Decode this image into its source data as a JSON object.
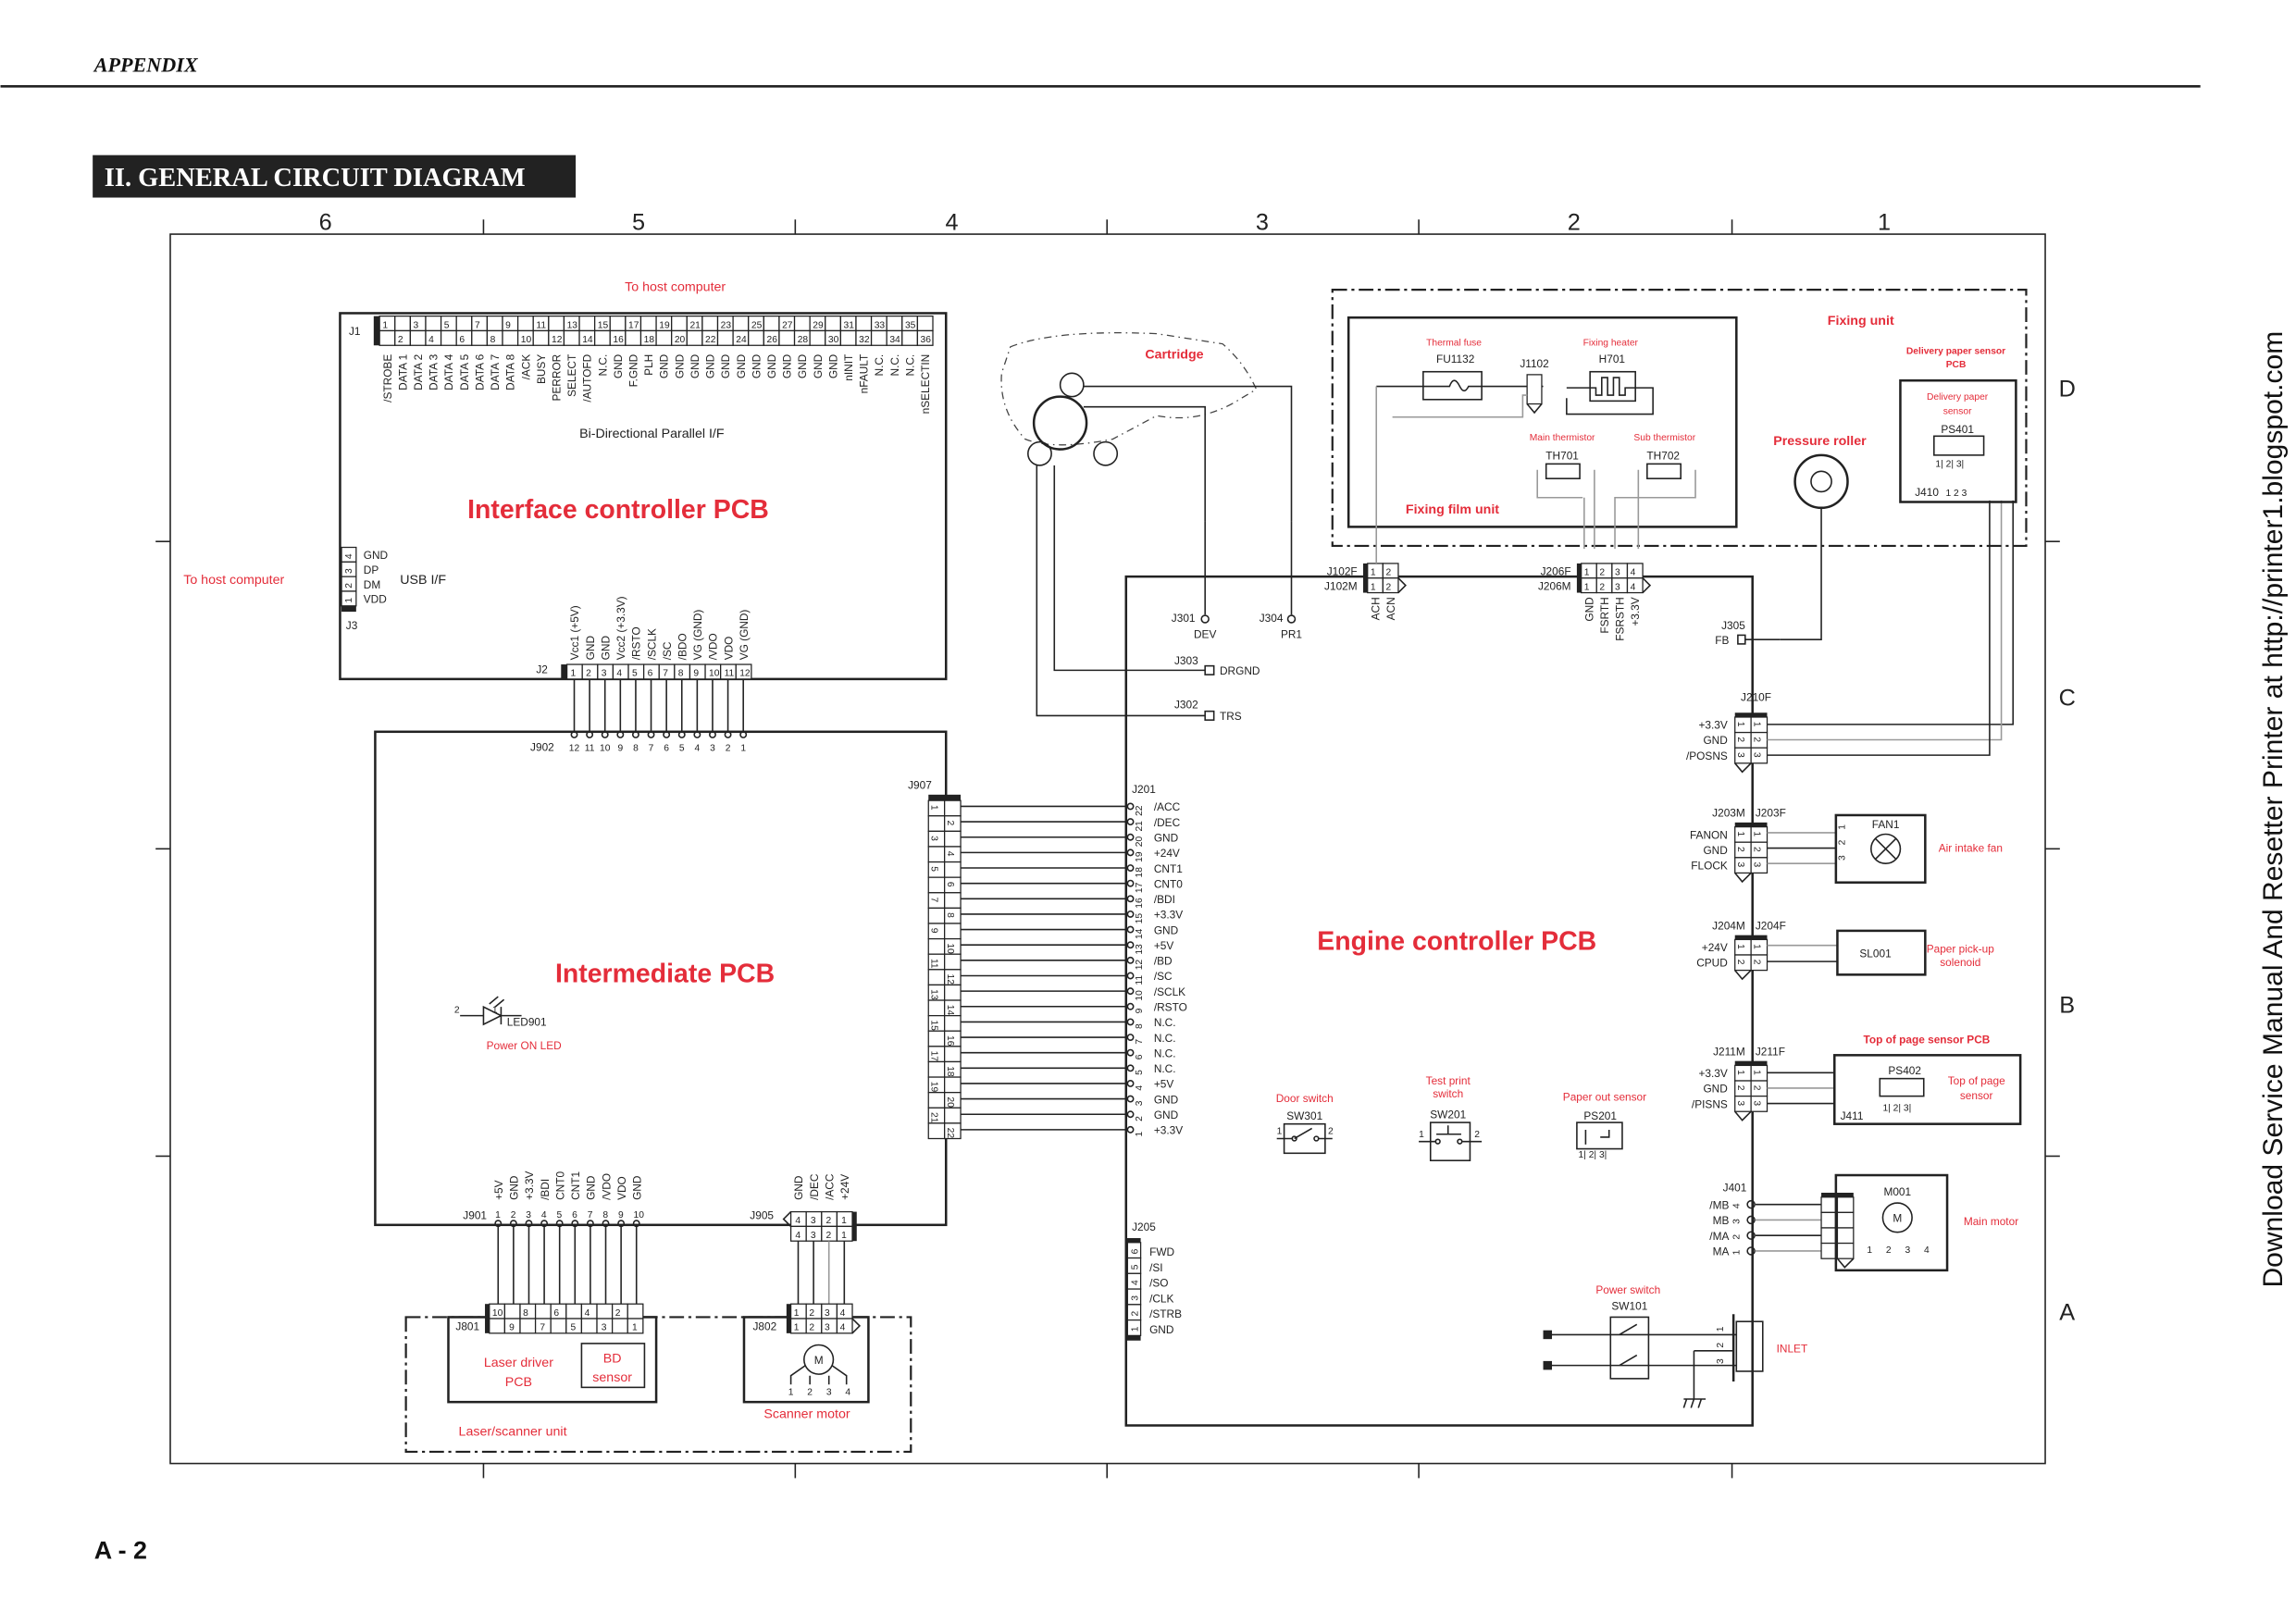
{
  "header": {
    "section": "APPENDIX",
    "title": "II. GENERAL CIRCUIT DIAGRAM",
    "page": "A - 2",
    "side_note": "Download Service Manual And Resetter Printer at http://printer1.blogspot.com"
  },
  "grid": {
    "columns": [
      "6",
      "5",
      "4",
      "3",
      "2",
      "1"
    ],
    "rows": [
      "D",
      "C",
      "B",
      "A"
    ]
  },
  "colors": {
    "label_red": "#e42d3a",
    "line": "#222222",
    "title_bg": "#222222"
  },
  "interface": {
    "title": "Interface controller PCB",
    "to_host_top": "To host computer",
    "to_host_left": "To host computer",
    "j1": {
      "name": "J1",
      "caption": "Bi-Directional Parallel I/F",
      "signals": [
        "/STROBE",
        "DATA 1",
        "DATA 2",
        "DATA 3",
        "DATA 4",
        "DATA 5",
        "DATA 6",
        "DATA 7",
        "DATA 8",
        "/ACK",
        "BUSY",
        "PERROR",
        "SELECT",
        "/AUTOFD",
        "N.C.",
        "GND",
        "F.GND",
        "PLH",
        "GND",
        "GND",
        "GND",
        "GND",
        "GND",
        "GND",
        "GND",
        "GND",
        "GND",
        "GND",
        "GND",
        "GND",
        "nINIT",
        "nFAULT",
        "N.C.",
        "N.C.",
        "N.C.",
        "nSELECTIN"
      ]
    },
    "j3": {
      "name": "J3",
      "caption": "USB I/F",
      "signals": [
        "GND",
        "DP",
        "DM",
        "VDD"
      ],
      "pins": [
        "4",
        "3",
        "2",
        "1"
      ]
    },
    "j2": {
      "name": "J2",
      "signals": [
        "Vcc1 (+5V)",
        "GND",
        "GND",
        "Vcc2 (+3.3V)",
        "/RSTO",
        "/SCLK",
        "/SC",
        "/BDO",
        "VG (GND)",
        "/VDO",
        "VDO",
        "VG (GND)"
      ]
    }
  },
  "intermediate": {
    "title": "Intermediate PCB",
    "j902": {
      "name": "J902",
      "pins": [
        "12",
        "11",
        "10",
        "9",
        "8",
        "7",
        "6",
        "5",
        "4",
        "3",
        "2",
        "1"
      ]
    },
    "j907": {
      "name": "J907"
    },
    "led": {
      "name": "LED901",
      "caption": "Power ON LED",
      "pin_a": "2",
      "pin_b": "1"
    },
    "j901": {
      "name": "J901",
      "signals": [
        "+5V",
        "GND",
        "+3.3V",
        "/BDI",
        "CNT0",
        "CNT1",
        "GND",
        "/VDO",
        "VDO",
        "GND"
      ]
    },
    "j905": {
      "name": "J905",
      "signals": [
        "GND",
        "/DEC",
        "/ACC",
        "+24V"
      ],
      "pins": [
        "4",
        "3",
        "2",
        "1"
      ]
    }
  },
  "laser_unit": {
    "title": "Laser/scanner unit",
    "driver": "Laser driver PCB",
    "driver_l1": "Laser driver",
    "driver_l2": "PCB",
    "bd_l1": "BD",
    "bd_l2": "sensor",
    "j801": {
      "name": "J801",
      "top": [
        "10",
        "",
        "8",
        "",
        "6",
        "",
        "4",
        "",
        "2",
        ""
      ],
      "bottom": [
        "",
        "9",
        "",
        "7",
        "",
        "5",
        "",
        "3",
        "",
        "1"
      ]
    },
    "j802": {
      "name": "J802",
      "pins": [
        "1",
        "2",
        "3",
        "4"
      ]
    },
    "scanner_motor": "Scanner motor",
    "motor_symbol": "M",
    "motor_pins": [
      "1",
      "2",
      "3",
      "4"
    ]
  },
  "cartridge": {
    "label": "Cartridge"
  },
  "engine": {
    "title": "Engine controller PCB",
    "j201": {
      "name": "J201",
      "signals": [
        "/ACC",
        "/DEC",
        "GND",
        "+24V",
        "CNT1",
        "CNT0",
        "/BDI",
        "+3.3V",
        "GND",
        "+5V",
        "/BD",
        "/SC",
        "/SCLK",
        "/RSTO",
        "N.C.",
        "N.C.",
        "N.C.",
        "N.C.",
        "+5V",
        "GND",
        "GND",
        "+3.3V"
      ],
      "pins": [
        "22",
        "21",
        "20",
        "19",
        "18",
        "17",
        "16",
        "15",
        "14",
        "13",
        "12",
        "11",
        "10",
        "9",
        "8",
        "7",
        "6",
        "5",
        "4",
        "3",
        "2",
        "1"
      ]
    },
    "j205": {
      "name": "J205",
      "signals": [
        "FWD",
        "/SI",
        "/SO",
        "/CLK",
        "/STRB",
        "GND"
      ],
      "pins": [
        "6",
        "5",
        "4",
        "3",
        "2",
        "1"
      ]
    },
    "j301": {
      "name": "J301",
      "signal": "DEV"
    },
    "j304": {
      "name": "J304",
      "signal": "PR1"
    },
    "j303": {
      "name": "J303",
      "signal": "DRGND"
    },
    "j302": {
      "name": "J302",
      "signal": "TRS"
    },
    "j305": {
      "name": "J305",
      "signal": "FB"
    },
    "j102": {
      "f": "J102F",
      "m": "J102M",
      "signals": [
        "ACH",
        "ACN"
      ],
      "pins": [
        "1",
        "2"
      ]
    },
    "j206": {
      "f": "J206F",
      "m": "J206M",
      "signals": [
        "GND",
        "FSRTH",
        "FSRSTH",
        "+3.3V"
      ],
      "pins": [
        "1",
        "2",
        "3",
        "4"
      ]
    },
    "j210": {
      "name": "J210F",
      "signals": [
        "+3.3V",
        "GND",
        "/POSNS"
      ]
    },
    "j203": {
      "m": "J203M",
      "f": "J203F",
      "signals": [
        "FANON",
        "GND",
        "FLOCK"
      ]
    },
    "j204": {
      "m": "J204M",
      "f": "J204F",
      "signals": [
        "+24V",
        "CPUD"
      ]
    },
    "j211": {
      "m": "J211M",
      "f": "J211F",
      "signals": [
        "+3.3V",
        "GND",
        "/PISNS"
      ]
    },
    "j401": {
      "name": "J401",
      "signals": [
        "/MB",
        "MB",
        "/MA",
        "MA"
      ],
      "pins": [
        "4",
        "3",
        "2",
        "1"
      ]
    }
  },
  "components": {
    "door_switch": {
      "label": "Door switch",
      "ref": "SW301",
      "p1": "1",
      "p2": "2"
    },
    "test_print": {
      "label_l1": "Test print",
      "label_l2": "switch",
      "ref": "SW201",
      "p1": "1",
      "p2": "2"
    },
    "paper_out": {
      "label": "Paper out sensor",
      "ref": "PS201",
      "pins": "1| 2| 3|"
    },
    "fan": {
      "ref": "FAN1",
      "label": "Air intake fan",
      "pins": [
        "1",
        "2",
        "3"
      ]
    },
    "solenoid": {
      "ref": "SL001",
      "label_l1": "Paper pick-up",
      "label_l2": "solenoid"
    },
    "top_sensor": {
      "pcb_label": "Top of page sensor PCB",
      "ref": "PS402",
      "label_l1": "Top of page",
      "label_l2": "sensor",
      "conn": "J411",
      "pins": "1| 2| 3|"
    },
    "main_motor": {
      "ref": "M001",
      "label": "Main motor",
      "symbol": "M",
      "pins": [
        "1",
        "2",
        "3",
        "4"
      ]
    },
    "power_switch": {
      "label": "Power switch",
      "ref": "SW101"
    },
    "inlet": {
      "label": "INLET",
      "pins": [
        "1",
        "2",
        "3"
      ]
    }
  },
  "fixing": {
    "title": "Fixing unit",
    "film_unit": "Fixing film unit",
    "thermal_fuse": {
      "label": "Thermal fuse",
      "ref": "FU1132"
    },
    "heater": {
      "label": "Fixing heater",
      "ref": "H701"
    },
    "conn": "J1102",
    "main_thermistor": {
      "label": "Main thermistor",
      "ref": "TH701"
    },
    "sub_thermistor": {
      "label": "Sub thermistor",
      "ref": "TH702"
    },
    "pressure_roller": "Pressure roller",
    "delivery_pcb_l1": "Delivery paper sensor",
    "delivery_pcb_l2": "PCB",
    "delivery_sensor_l1": "Delivery paper",
    "delivery_sensor_l2": "sensor",
    "delivery_ref": "PS401",
    "delivery_conn": "J410",
    "delivery_pins": "1| 2| 3|",
    "j410_pins": "1  2  3"
  }
}
